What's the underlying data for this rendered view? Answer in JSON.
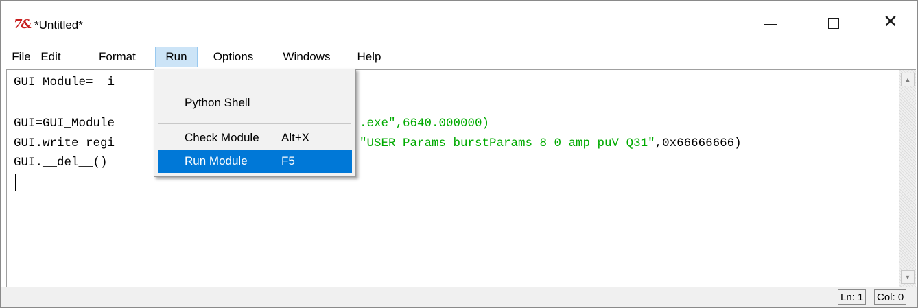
{
  "window": {
    "title": "*Untitled*",
    "icon": "tk-feather-icon"
  },
  "menubar": {
    "items": [
      {
        "label": "File"
      },
      {
        "label": "Edit"
      },
      {
        "label": "Format"
      },
      {
        "label": "Run"
      },
      {
        "label": "Options"
      },
      {
        "label": "Windows"
      },
      {
        "label": "Help"
      }
    ],
    "active": "Run"
  },
  "editor": {
    "lines": [
      {
        "visible": "GUI_Module=__i"
      },
      {
        "visible": ""
      },
      {
        "visible": "GUI=GUI_Module",
        "tail_normal": ".exe\",6640.000000)"
      },
      {
        "visible": "GUI.write_regi",
        "tail_string": "\"USER_Params_burstParams_8_0_amp_puV_Q31\"",
        "tail_rest": ",0x66666666)"
      },
      {
        "visible": "GUI.__del__()"
      }
    ],
    "string_color": "#00aa00"
  },
  "run_menu": {
    "items": [
      {
        "label": "Python Shell",
        "accel": ""
      },
      {
        "label": "Check Module",
        "accel": "Alt+X"
      },
      {
        "label": "Run Module",
        "accel": "F5"
      }
    ],
    "selected": "Run Module",
    "highlight_color": "#0078d7"
  },
  "statusbar": {
    "line": "Ln: 1",
    "col": "Col: 0"
  }
}
